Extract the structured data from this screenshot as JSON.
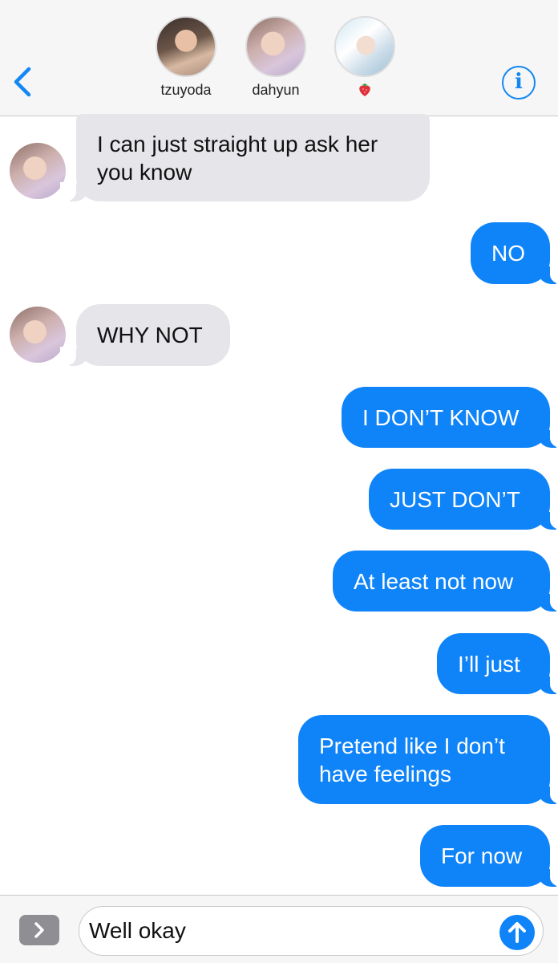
{
  "header": {
    "back_label": "Back",
    "info_label": "i",
    "contacts": [
      {
        "name": "tzuyoda"
      },
      {
        "name": "dahyun"
      },
      {
        "name": ""
      }
    ]
  },
  "messages": [
    {
      "from": "them",
      "text": "I can just straight up ask her you know"
    },
    {
      "from": "me",
      "text": "NO"
    },
    {
      "from": "them",
      "text": "WHY NOT"
    },
    {
      "from": "me",
      "text": "I DON’T KNOW"
    },
    {
      "from": "me",
      "text": "JUST DON’T"
    },
    {
      "from": "me",
      "text": "At least not now"
    },
    {
      "from": "me",
      "text": "I’ll just"
    },
    {
      "from": "me",
      "text": "Pretend like I don’t have feelings"
    },
    {
      "from": "me",
      "text": "For now"
    }
  ],
  "composer": {
    "value": "Well okay"
  },
  "colors": {
    "accent": "#0f83f8",
    "received_bubble": "#e5e5ea",
    "header_bg": "#f6f6f7"
  },
  "icons": {
    "back": "chevron-left-icon",
    "info": "info-icon",
    "expand": "chevron-right-icon",
    "send": "arrow-up-icon",
    "strawberry": "strawberry-icon"
  }
}
